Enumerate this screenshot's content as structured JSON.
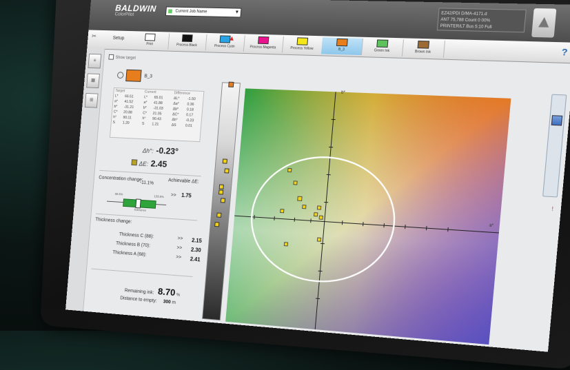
{
  "header": {
    "brand": "BALDWIN",
    "brand_sub": "ColorPilot",
    "profile_select": "Current Job Name",
    "stats_lines": [
      "EZ42/PDI   D/MA-4171.d",
      "ANT 75,788   Count 0 00%",
      "PRINTER/LT   Bus   5:10 Full"
    ]
  },
  "inkbar": {
    "setup_label": "Setup",
    "inks": [
      {
        "name": "Print",
        "color": "#ffffff"
      },
      {
        "name": "Process Black",
        "color": "#111111"
      },
      {
        "name": "Process Cyan",
        "color": "#2aa3e4",
        "warning": true
      },
      {
        "name": "Process Magenta",
        "color": "#e8138d"
      },
      {
        "name": "Process Yellow",
        "color": "#f3e719"
      },
      {
        "name": "B_3",
        "color": "#e77e1d",
        "active": true
      },
      {
        "name": "Green Ink",
        "color": "#5dc45c"
      },
      {
        "name": "Brown Ink",
        "color": "#9c6a35"
      }
    ],
    "help": "?"
  },
  "sidebar": {
    "buttons": [
      "≡",
      "▦",
      "⊞"
    ]
  },
  "panel": {
    "checkbox_label": "Show target",
    "target_name": "B_3",
    "target_color": "#e77e1d",
    "measurements": {
      "headers": [
        "Target",
        "Current",
        "Difference"
      ],
      "rows": [
        [
          "L*",
          "66.51",
          "L*",
          "65.01",
          "ΔL*",
          "-1.50"
        ],
        [
          "a*",
          "41.52",
          "a*",
          "41.88",
          "Δa*",
          "0.36"
        ],
        [
          "b*",
          "-31.21",
          "b*",
          "-31.03",
          "Δb*",
          "0.18"
        ],
        [
          "C*",
          "20.88",
          "C*",
          "21.05",
          "ΔC*",
          "0.17"
        ],
        [
          "h°",
          "90.11",
          "h°",
          "90.43",
          "Δh°",
          "-0.23"
        ],
        [
          "S",
          "1.20",
          "S",
          "1.21",
          "ΔS",
          "0.01"
        ]
      ]
    },
    "delta_h_label": "Δh°:",
    "delta_h_value": "-0.23°",
    "delta_e_label": "ΔE:",
    "delta_e_value": "2.45",
    "concentration_label": "Concentration change:",
    "concentration_value": "-11.1%",
    "achievable_label": "Achievable ΔE:",
    "achievable_arrow": ">>",
    "achievable_value": "1.75",
    "slider": {
      "low": "66.5%",
      "high": "133.6%",
      "caption": "Tolerance",
      "position": 0.45
    },
    "thickness_title": "Thickness change:",
    "thickness": [
      {
        "label": "Thickness C (88):",
        "arrow": ">>",
        "value": "2.15"
      },
      {
        "label": "Thickness B (70):",
        "arrow": ">>",
        "value": "2.30"
      },
      {
        "label": "Thickness A (68):",
        "arrow": ">>",
        "value": "2.41"
      }
    ],
    "remaining_label": "Remaining ink:",
    "remaining_value": "8.70",
    "remaining_unit": "%",
    "distance_label": "Distance to empty:",
    "distance_value": "300",
    "distance_unit": "m"
  },
  "plot": {
    "y_axis_label": "b*",
    "x_axis_label": "a*"
  }
}
